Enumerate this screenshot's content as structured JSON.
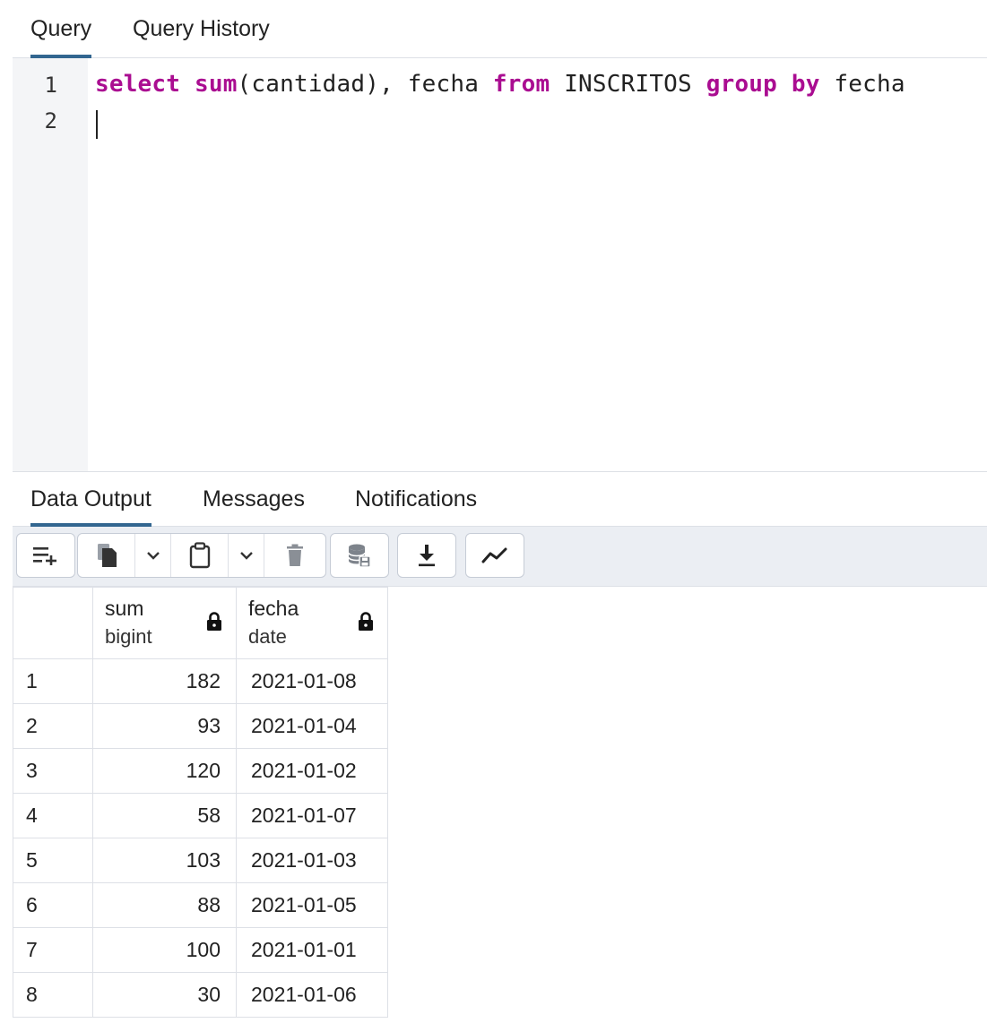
{
  "editor_tabs": [
    {
      "label": "Query",
      "active": true
    },
    {
      "label": "Query History",
      "active": false
    }
  ],
  "editor": {
    "line_numbers": [
      "1",
      "2"
    ],
    "line1": {
      "t1": "select",
      "t2": " ",
      "t3": "sum",
      "t4": "(cantidad), fecha ",
      "t5": "from",
      "t6": " INSCRITOS ",
      "t7": "group by",
      "t8": " fecha"
    },
    "line2": ""
  },
  "output_tabs": [
    {
      "label": "Data Output",
      "active": true
    },
    {
      "label": "Messages",
      "active": false
    },
    {
      "label": "Notifications",
      "active": false
    }
  ],
  "toolbar": {
    "icons": [
      "add-row-icon",
      "copy-icon",
      "chevron-down-icon",
      "paste-icon",
      "chevron-down-icon",
      "delete-icon",
      "save-data-icon",
      "download-icon",
      "graph-icon"
    ]
  },
  "grid": {
    "columns": [
      {
        "name": "sum",
        "type": "bigint"
      },
      {
        "name": "fecha",
        "type": "date"
      }
    ],
    "rows": [
      {
        "num": "1",
        "sum": "182",
        "fecha": "2021-01-08"
      },
      {
        "num": "2",
        "sum": "93",
        "fecha": "2021-01-04"
      },
      {
        "num": "3",
        "sum": "120",
        "fecha": "2021-01-02"
      },
      {
        "num": "4",
        "sum": "58",
        "fecha": "2021-01-07"
      },
      {
        "num": "5",
        "sum": "103",
        "fecha": "2021-01-03"
      },
      {
        "num": "6",
        "sum": "88",
        "fecha": "2021-01-05"
      },
      {
        "num": "7",
        "sum": "100",
        "fecha": "2021-01-01"
      },
      {
        "num": "8",
        "sum": "30",
        "fecha": "2021-01-06"
      }
    ]
  },
  "colors": {
    "accent": "#326690",
    "keyword": "#aa0d91",
    "gutter": "#f4f5f7",
    "toolbar": "#ebeef3"
  }
}
